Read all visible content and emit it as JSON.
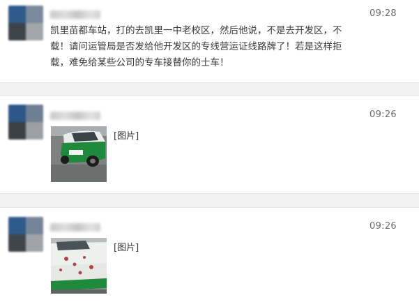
{
  "messages": [
    {
      "time": "09:28",
      "text": "凯里苗都车站，打的去凯里一中老校区，然后他说，不是去开发区，不载！请问运管局是否发给他开发区的专线营运证线路牌了！若是这样拒载，难免给某些公司的专车接替你的士车！"
    },
    {
      "time": "09:26",
      "image_label": "[图片]"
    },
    {
      "time": "09:26",
      "image_label": "[图片]"
    }
  ],
  "colors": {
    "avatar_blue": "#2f5a8c",
    "avatar_dark": "#3e4348",
    "avatar_gray": "#8b8f95",
    "taxi_green": "#1f8a3c",
    "divider": "#e6e6e6"
  },
  "icons": [
    "avatar",
    "taxi-photo"
  ]
}
